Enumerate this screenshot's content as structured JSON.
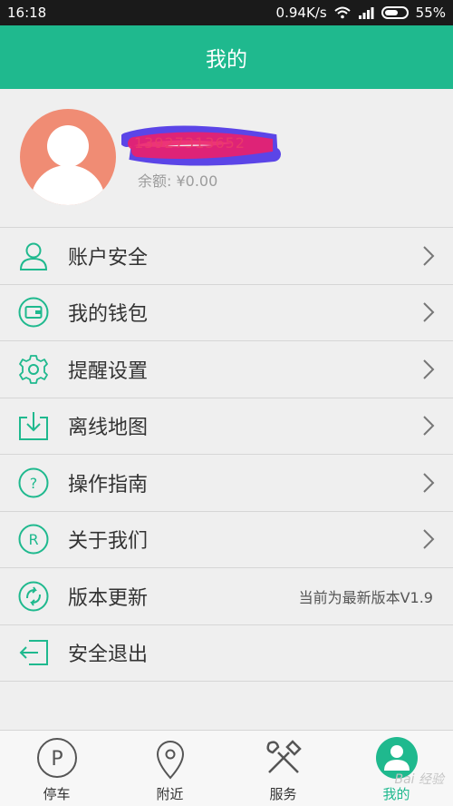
{
  "status": {
    "time": "16:18",
    "speed": "0.94K/s",
    "battery": "55%"
  },
  "header": {
    "title": "我的"
  },
  "profile": {
    "phone": "13927313652",
    "balance": "余额: ¥0.00"
  },
  "menu": [
    {
      "label": "账户安全",
      "icon": "user-icon"
    },
    {
      "label": "我的钱包",
      "icon": "wallet-icon"
    },
    {
      "label": "提醒设置",
      "icon": "gear-icon"
    },
    {
      "label": "离线地图",
      "icon": "download-icon"
    },
    {
      "label": "操作指南",
      "icon": "question-icon"
    },
    {
      "label": "关于我们",
      "icon": "r-circle-icon"
    },
    {
      "label": "版本更新",
      "icon": "refresh-icon",
      "extra": "当前为最新版本V1.9"
    },
    {
      "label": "安全退出",
      "icon": "logout-icon"
    }
  ],
  "tabs": [
    {
      "label": "停车",
      "icon": "parking-icon"
    },
    {
      "label": "附近",
      "icon": "location-icon"
    },
    {
      "label": "服务",
      "icon": "tools-icon"
    },
    {
      "label": "我的",
      "icon": "profile-icon",
      "active": true
    }
  ],
  "watermark": "Bai 经验",
  "colors": {
    "accent": "#1fb98e",
    "avatar": "#f08c74",
    "redaction": "#e93a6a"
  }
}
